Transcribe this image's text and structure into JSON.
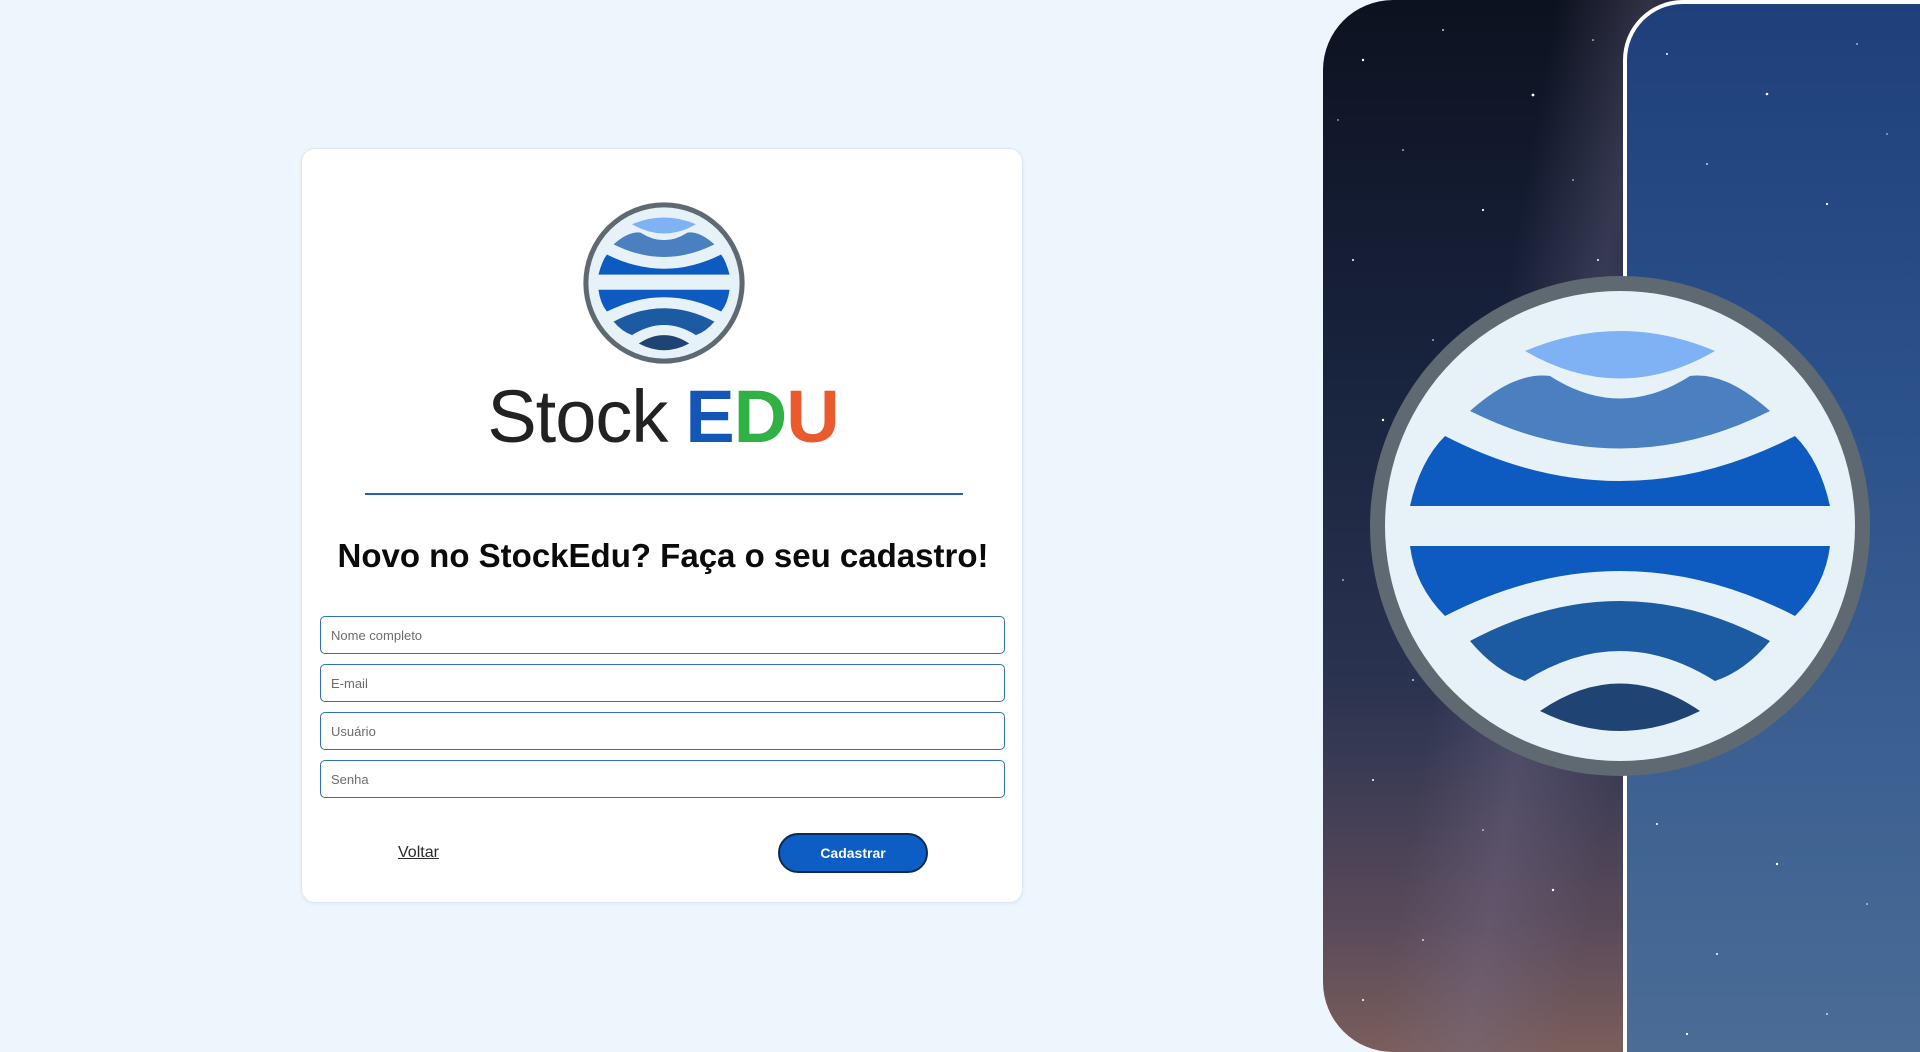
{
  "brand": {
    "word_stock": "Stock",
    "letter_e": "E",
    "letter_d": "D",
    "letter_u": "U",
    "colors": {
      "stock": "#222222",
      "e": "#1456b8",
      "d": "#2fb143",
      "u": "#ea5a2c"
    }
  },
  "signup": {
    "heading": "Novo no StockEdu? Faça o seu cadastro!",
    "fields": {
      "full_name_placeholder": "Nome completo",
      "email_placeholder": "E-mail",
      "username_placeholder": "Usuário",
      "password_placeholder": "Senha"
    },
    "back_label": "Voltar",
    "submit_label": "Cadastrar"
  },
  "icons": {
    "logo": "globe-logo-icon",
    "hero": "globe-hero-icon"
  },
  "colors": {
    "page_bg": "#eef6fd",
    "accent": "#0c5ec4",
    "field_border": "#2f6fc0"
  }
}
